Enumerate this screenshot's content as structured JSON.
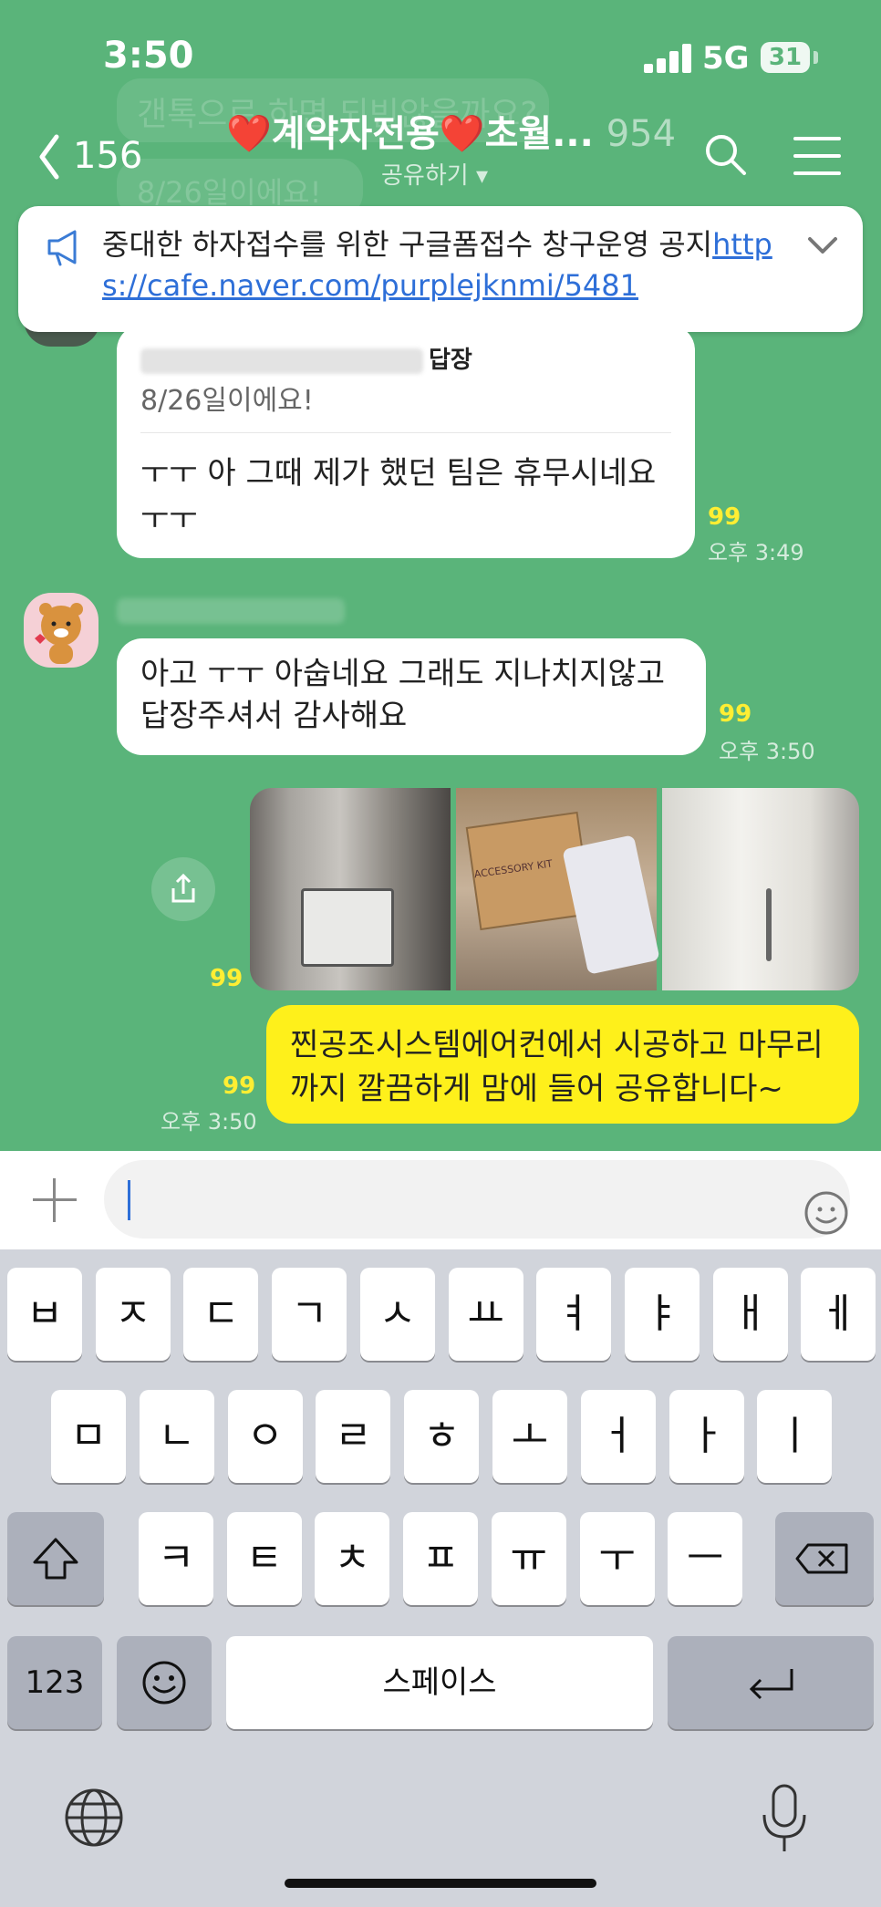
{
  "status_bar": {
    "time": "3:50",
    "network": "5G",
    "battery": "31"
  },
  "header": {
    "back_count": "156",
    "title": "❤️계약자전용❤️초월...",
    "member_count": "954",
    "subtitle": "공유하기 ▾"
  },
  "background_messages": {
    "ghost_1": "갠톡으로 하면 되빈않을까요?",
    "ghost_2": "8/26일이에요!"
  },
  "notice": {
    "text": "중대한 하자접수를 위한 구글폼접수 창구운영 공지",
    "link": "https://cafe.naver.com/purplejknmi/5481"
  },
  "messages": [
    {
      "type": "reply",
      "reply_label": "답장",
      "quoted": "8/26일이에요!",
      "text": "ㅜㅜ 아 그때 제가 했던 팀은 휴무시네요 ㅜㅜ",
      "unread": "99",
      "time": "오후 3:49"
    },
    {
      "type": "text",
      "text": "아고 ㅜㅜ 아숩네요 그래도 지나치지않고 답장주셔서 감사해요",
      "unread": "99",
      "time": "오후 3:50"
    },
    {
      "type": "photos",
      "count": 3,
      "unread": "99",
      "photo_text": "ACCESSORY KIT"
    },
    {
      "type": "mine",
      "text": "찐공조시스템에어컨에서 시공하고 마무리까지 깔끔하게 맘에 들어 공유합니다~",
      "unread": "99",
      "time": "오후 3:50"
    }
  ],
  "input": {
    "hash_label": "#"
  },
  "keyboard": {
    "row1": [
      "ㅂ",
      "ㅈ",
      "ㄷ",
      "ㄱ",
      "ㅅ",
      "ㅛ",
      "ㅕ",
      "ㅑ",
      "ㅐ",
      "ㅔ"
    ],
    "row2": [
      "ㅁ",
      "ㄴ",
      "ㅇ",
      "ㄹ",
      "ㅎ",
      "ㅗ",
      "ㅓ",
      "ㅏ",
      "ㅣ"
    ],
    "row3": [
      "ㅋ",
      "ㅌ",
      "ㅊ",
      "ㅍ",
      "ㅠ",
      "ㅜ",
      "ㅡ"
    ],
    "numbers_label": "123",
    "space_label": "스페이스"
  },
  "colors": {
    "chat_bg": "#5ab47a",
    "my_bubble": "#fef01b",
    "unread": "#ffee33",
    "link": "#2e6fd8"
  }
}
